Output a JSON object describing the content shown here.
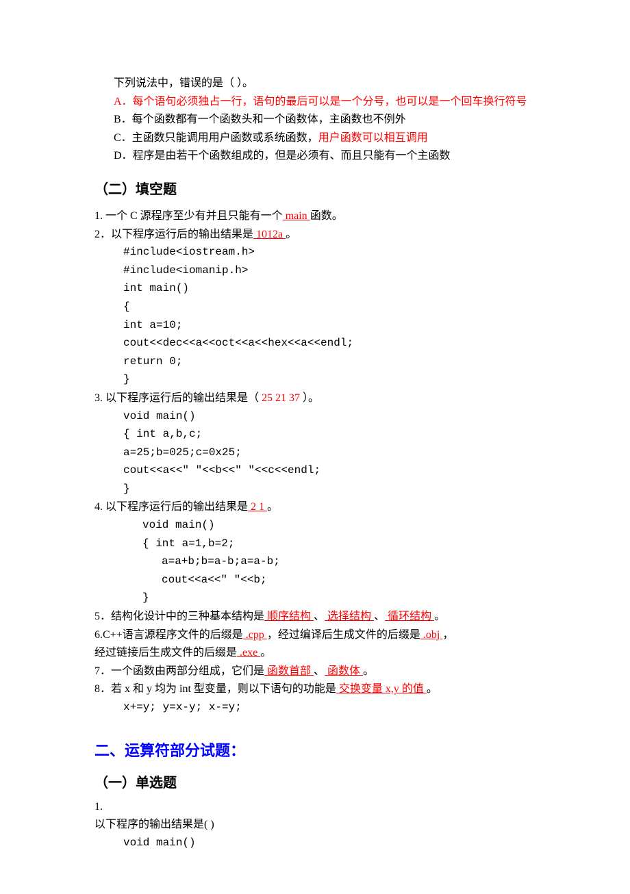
{
  "q_prev": {
    "stem_line": "下列说法中，错误的是（  ）。",
    "opts": {
      "A": "A．每个语句必须独占一行，语句的最后可以是一个分号，也可以是一个回车换行符号",
      "B_pre": "B．每个函数都有一个函数头和一个函数体，主函数也不例外",
      "C_pre": "C．主函数只能调用用户函数或系统函数，",
      "C_red": "用户函数可以相互调用",
      "D": "D．程序是由若干个函数组成的，但是必须有、而且只能有一个主函数"
    }
  },
  "fill_heading": "（二）填空题",
  "fill": {
    "q1": {
      "pre": "1. 一个 C 源程序至少有并且只能有一个",
      "ans": "   main     ",
      "post": "函数。"
    },
    "q2": {
      "pre": "2．以下程序运行后的输出结果是",
      "ans": "  1012a             ",
      "post": "。",
      "code": [
        "#include<iostream.h>",
        "#include<iomanip.h>",
        "int   main()",
        " {",
        "  int a=10;",
        "  cout<<dec<<a<<oct<<a<<hex<<a<<endl;",
        "return 0;",
        " }"
      ]
    },
    "q3": {
      "pre": "3. 以下程序运行后的输出结果是（",
      "ans": "  25   21   37           ",
      "post": "）。",
      "code": [
        "void main()",
        " { int a,b,c;",
        "  a=25;b=025;c=0x25;",
        "  cout<<a<<\" \"<<b<<\" \"<<c<<endl;",
        " }"
      ]
    },
    "q4": {
      "pre": "4. 以下程序运行后的输出结果是",
      "ans": "  2 1       ",
      "post": "。",
      "code": [
        "void main()",
        " { int a=1,b=2;",
        "    a=a+b;b=a-b;a=a-b;",
        "    cout<<a<<\" \"<<b;",
        " }"
      ]
    },
    "q5": {
      "pre": "5．结构化设计中的三种基本结构是",
      "a1": "  顺序结构       ",
      "sep1": "、",
      "a2": "  选择结构      ",
      "sep2": "、",
      "a3": "  循环结构   ",
      "post": "。"
    },
    "q6": {
      "pre": "6.C++语言源程序文件的后缀是",
      "a1": "   .cpp     ",
      "mid1": "，经过编译后生成文件的后缀是",
      "a2": "  .obj       ",
      "post1": "，",
      "line2_pre": "经过链接后生成文件的后缀是",
      "a3": "  .exe       ",
      "post2": "。"
    },
    "q7": {
      "pre": "7．一个函数由两部分组成，它们是",
      "a1": "  函数首部      ",
      "sep": "、",
      "a2": "  函数体      ",
      "post": "。"
    },
    "q8": {
      "pre": "8．若 x 和 y 均为 int 型变量，则以下语句的功能是",
      "ans": "  交换变量 x,y 的值    ",
      "post": "。",
      "code": "x+=y;     y=x-y;    x-=y;"
    }
  },
  "part2_heading": "二、运算符部分试题：",
  "mc_heading": "（一）单选题",
  "mc1": {
    "num": "1.",
    "stem": "以下程序的输出结果是(   )",
    "code": "void main()"
  }
}
